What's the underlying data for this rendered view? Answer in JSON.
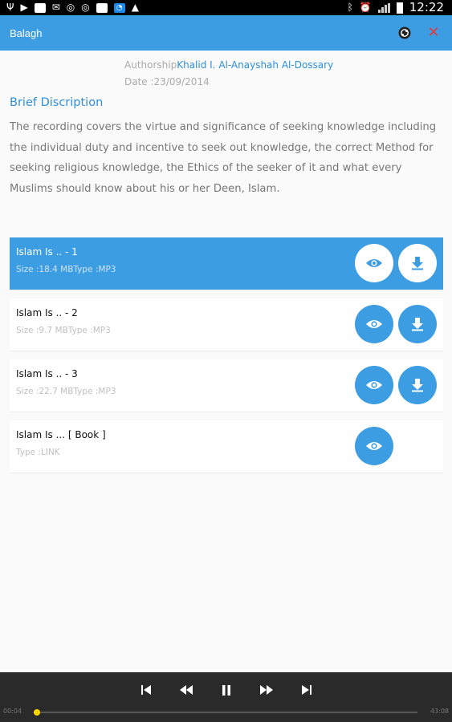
{
  "status_bar": {
    "time": "12:22"
  },
  "app": {
    "title": "Balagh"
  },
  "meta": {
    "author_label": "Authorship",
    "author_name": "Khalid I. Al-Anayshah Al-Dossary",
    "date_label": "Date :",
    "date_value": "23/09/2014"
  },
  "section_title": "Brief Discription",
  "description": "The recording covers the virtue and significance of seeking knowledge including the individual duty and incentive to seek out knowledge, the correct Method for seeking religious knowledge, the Ethics of the seeker of it and what every Muslims should know about his or her Deen, Islam.",
  "items": [
    {
      "title": "Islam Is .. - 1",
      "meta": "Size :18.4 MBType :MP3",
      "selected": true
    },
    {
      "title": "Islam Is .. - 2",
      "meta": "Size :9.7 MBType :MP3",
      "selected": false
    },
    {
      "title": "Islam Is .. - 3",
      "meta": "Size :22.7 MBType :MP3",
      "selected": false
    },
    {
      "title": "Islam Is ... [ Book ]",
      "meta": "Type :LINK",
      "selected": false
    }
  ],
  "player": {
    "elapsed": "00:04",
    "duration": "43:08",
    "progress": 0.009
  },
  "colors": {
    "accent": "#3d9de3",
    "close": "#e53935",
    "seek": "#ffd500"
  }
}
